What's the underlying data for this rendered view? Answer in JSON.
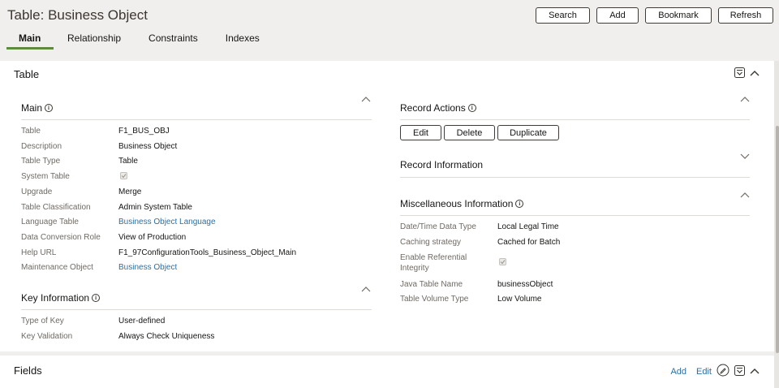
{
  "page": {
    "title": "Table: Business Object"
  },
  "toolbar": {
    "search": "Search",
    "add": "Add",
    "bookmark": "Bookmark",
    "refresh": "Refresh"
  },
  "tabs": [
    {
      "label": "Main"
    },
    {
      "label": "Relationship"
    },
    {
      "label": "Constraints"
    },
    {
      "label": "Indexes"
    }
  ],
  "panel": {
    "title": "Table"
  },
  "main": {
    "title": "Main",
    "fields": [
      {
        "label": "Table",
        "value": "F1_BUS_OBJ"
      },
      {
        "label": "Description",
        "value": "Business Object"
      },
      {
        "label": "Table Type",
        "value": "Table"
      },
      {
        "label": "System Table",
        "value": ""
      },
      {
        "label": "Upgrade",
        "value": "Merge"
      },
      {
        "label": "Table Classification",
        "value": "Admin System Table"
      },
      {
        "label": "Language Table",
        "value": "Business Object Language"
      },
      {
        "label": "Data Conversion Role",
        "value": "View of Production"
      },
      {
        "label": "Help URL",
        "value": "F1_97ConfigurationTools_Business_Object_Main"
      },
      {
        "label": "Maintenance Object",
        "value": "Business Object"
      }
    ]
  },
  "key_info": {
    "title": "Key Information",
    "fields": [
      {
        "label": "Type of Key",
        "value": "User-defined"
      },
      {
        "label": "Key Validation",
        "value": "Always Check Uniqueness"
      }
    ]
  },
  "record_actions": {
    "title": "Record Actions",
    "edit": "Edit",
    "delete": "Delete",
    "duplicate": "Duplicate"
  },
  "record_info": {
    "title": "Record Information"
  },
  "misc": {
    "title": "Miscellaneous Information",
    "fields": [
      {
        "label": "Date/Time Data Type",
        "value": "Local Legal Time"
      },
      {
        "label": "Caching strategy",
        "value": "Cached for Batch"
      },
      {
        "label": "Enable Referential",
        "label2": "Integrity",
        "value": ""
      },
      {
        "label": "Java Table Name",
        "value": "businessObject"
      },
      {
        "label": "Table Volume Type",
        "value": "Low Volume"
      }
    ]
  },
  "fields_section": {
    "title": "Fields",
    "add": "Add",
    "edit": "Edit"
  },
  "colors": {
    "accent": "#5e8a3c",
    "link": "#2a6fa5",
    "text": "#161513",
    "label": "#6f6a64"
  },
  "icons": {
    "info": "info-icon",
    "collapse": "chevron-up-icon",
    "expand": "chevron-down-icon",
    "menu": "dropdown-menu-icon",
    "edit": "pencil-icon"
  }
}
